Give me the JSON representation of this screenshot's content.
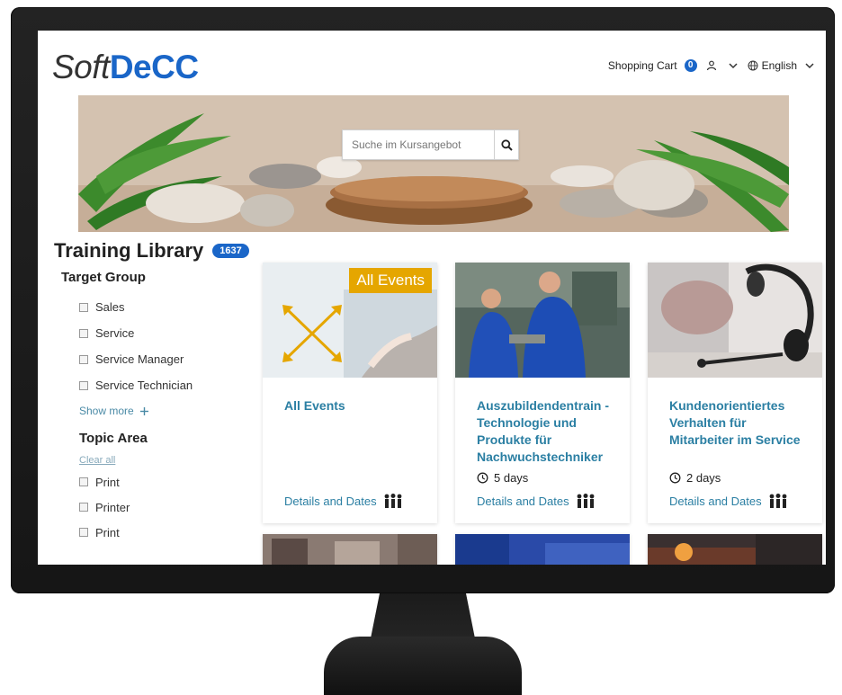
{
  "header": {
    "logo_soft": "Soft",
    "logo_decc": "DeCC",
    "cart_label": "Shopping Cart",
    "cart_count": "0",
    "language": "English"
  },
  "hero": {
    "search_placeholder": "Suche im Kursangebot"
  },
  "library": {
    "title": "Training Library",
    "count": "1637"
  },
  "sidebar": {
    "target_group_heading": "Target Group",
    "target_items": [
      "Sales",
      "Service",
      "Service Manager",
      "Service Technician"
    ],
    "show_more": "Show more",
    "topic_heading": "Topic Area",
    "clear_all": "Clear all",
    "topic_items": [
      "Print",
      "Printer",
      "Print"
    ]
  },
  "cards": [
    {
      "banner": "All Events",
      "title": "All Events",
      "duration": "",
      "link": "Details and Dates"
    },
    {
      "banner": "",
      "title": "Auszubildendentrain - Technologie und Produkte für Nachwuchstechniker",
      "duration": "5  days",
      "link": "Details and Dates"
    },
    {
      "banner": "",
      "title": "Kundenorientiertes Verhalten für Mitarbeiter im Service",
      "duration": "2  days",
      "link": "Details and Dates"
    }
  ],
  "colors": {
    "brand_blue": "#1a66c8",
    "link_teal": "#2b7fa3",
    "banner_gold": "#e5a600"
  }
}
